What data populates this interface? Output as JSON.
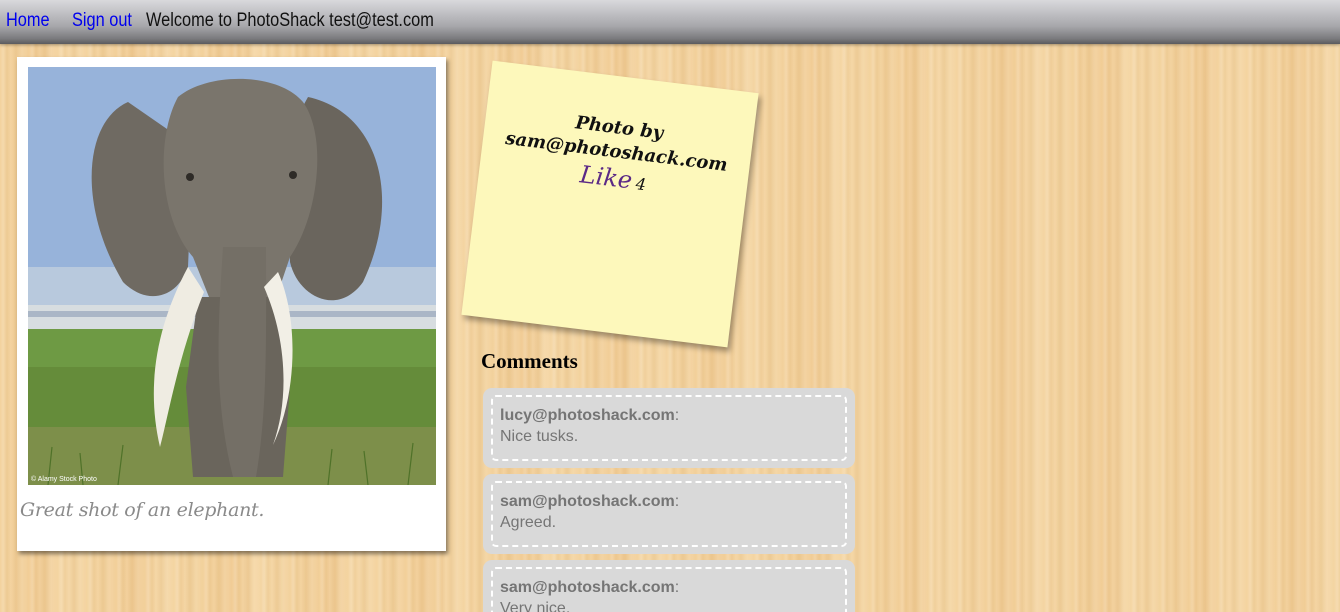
{
  "nav": {
    "home": "Home",
    "sign_out": "Sign out",
    "welcome": "Welcome to PhotoShack test@test.com"
  },
  "photo": {
    "watermark": "© Alamy Stock Photo",
    "caption": "Great shot of an elephant."
  },
  "sticky": {
    "credit_prefix": "Photo by",
    "credit_author": "sam@photoshack.com",
    "like_label": "Like",
    "like_count": "4"
  },
  "comments": {
    "title": "Comments",
    "items": [
      {
        "author": "lucy@photoshack.com",
        "separator": ":",
        "text": "Nice tusks."
      },
      {
        "author": "sam@photoshack.com",
        "separator": ":",
        "text": "Agreed."
      },
      {
        "author": "sam@photoshack.com",
        "separator": ":",
        "text": "Very nice."
      }
    ]
  },
  "colors": {
    "link": "#0000ee",
    "like": "#5b2a86",
    "sticky_note": "#fdf8bb",
    "comment_bg": "#d9d9d9"
  }
}
